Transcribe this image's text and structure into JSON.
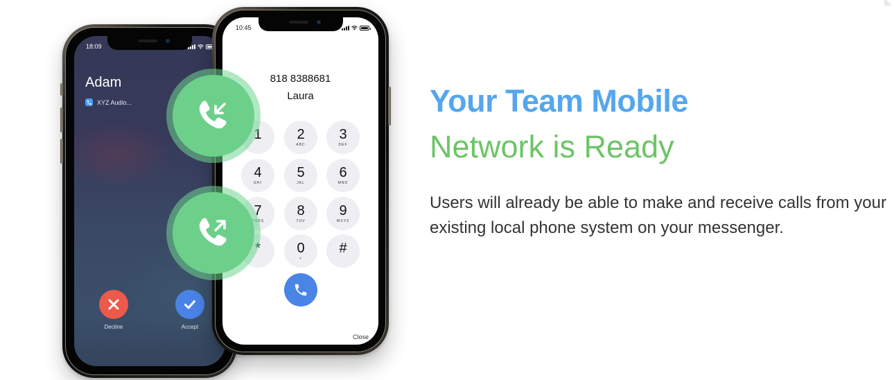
{
  "colors": {
    "headline_blue": "#55a6ee",
    "headline_green": "#6cc565",
    "badge_green": "#6dd08a",
    "decline_red": "#ec5a4b",
    "accept_blue": "#4a83e6",
    "call_blue": "#4a84e6",
    "body_text": "#333333"
  },
  "incoming_phone": {
    "status_time": "18:09",
    "caller_name": "Adam",
    "app_icon": "phone-app-icon",
    "app_label": "XYZ Audio...",
    "decline_label": "Decline",
    "decline_icon": "x-icon",
    "accept_label": "Accept",
    "accept_icon": "checkmark-icon"
  },
  "dialer_phone": {
    "status_time": "10:45",
    "dialed_number": "818 8388681",
    "contact_name": "Laura",
    "keys": [
      {
        "digit": "1",
        "letters": ""
      },
      {
        "digit": "2",
        "letters": "ABC"
      },
      {
        "digit": "3",
        "letters": "DEF"
      },
      {
        "digit": "4",
        "letters": "GHI"
      },
      {
        "digit": "5",
        "letters": "JKL"
      },
      {
        "digit": "6",
        "letters": "MNO"
      },
      {
        "digit": "7",
        "letters": "PQRS"
      },
      {
        "digit": "8",
        "letters": "TUV"
      },
      {
        "digit": "9",
        "letters": "WXYZ"
      },
      {
        "digit": "*",
        "letters": ""
      },
      {
        "digit": "0",
        "letters": "+"
      },
      {
        "digit": "#",
        "letters": ""
      }
    ],
    "call_icon": "phone-icon",
    "close_label": "Close"
  },
  "badges": {
    "incoming_icon": "incoming-call-icon",
    "outgoing_icon": "outgoing-call-icon"
  },
  "content": {
    "headline_line1": "Your Team Mobile",
    "headline_line2": "Network is Ready",
    "body": "Users will already be able to make and receive calls from your existing local phone system on your messenger."
  }
}
